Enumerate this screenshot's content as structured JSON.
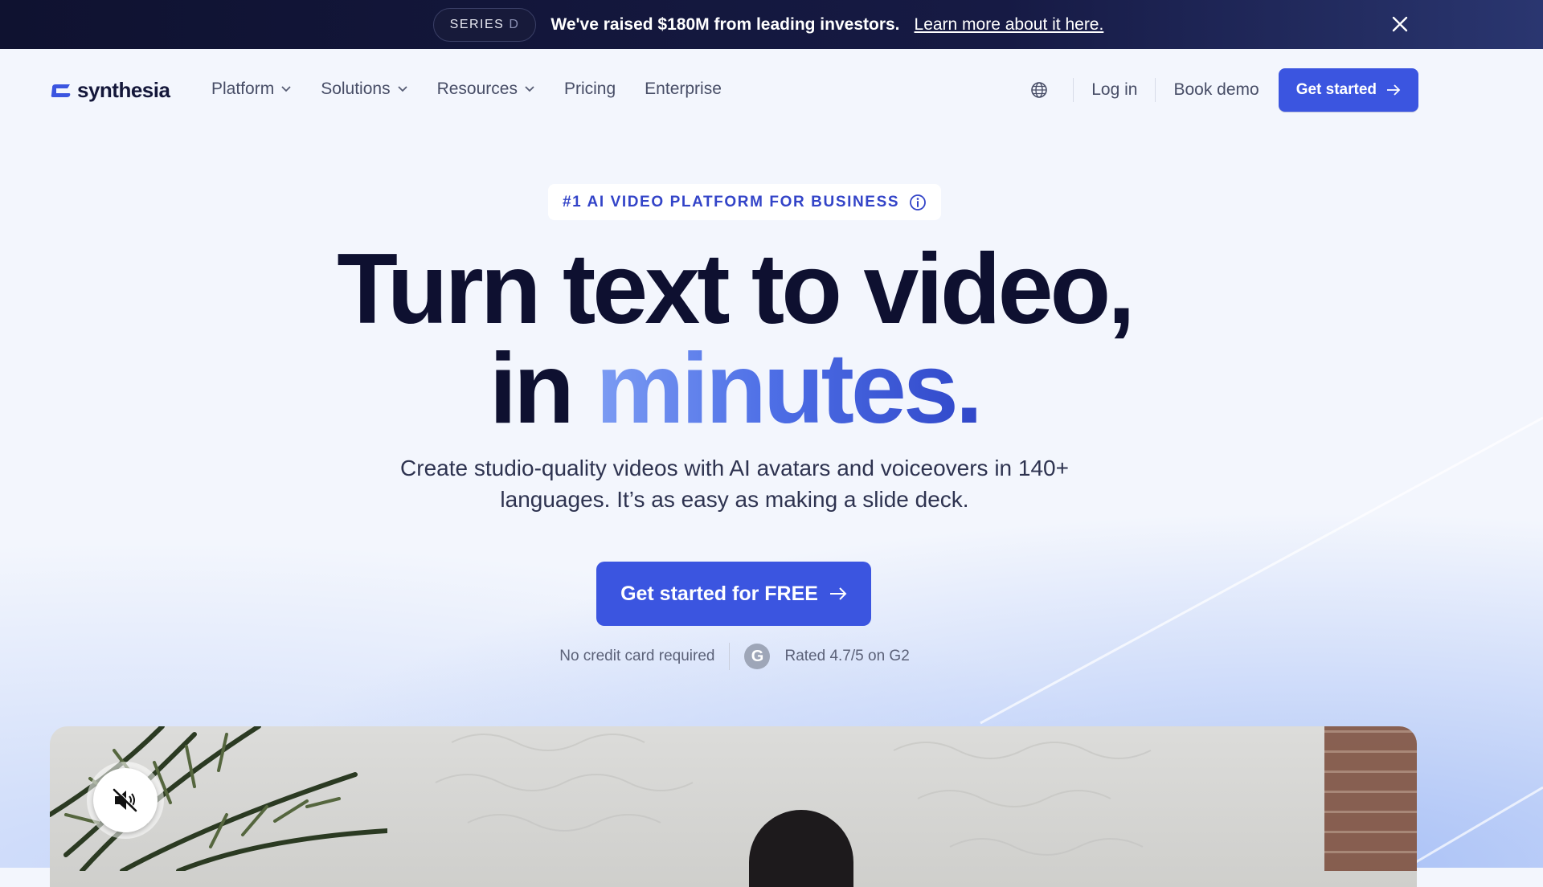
{
  "banner": {
    "series_part1": "SERIES",
    "series_part2": "D",
    "text": "We've raised $180M from leading investors.",
    "link": "Learn more about it here."
  },
  "brand": {
    "name": "synthesia",
    "accent": "#3b55e0",
    "dark": "#0e1030"
  },
  "nav": {
    "items": [
      {
        "label": "Platform",
        "dropdown": true
      },
      {
        "label": "Solutions",
        "dropdown": true
      },
      {
        "label": "Resources",
        "dropdown": true
      },
      {
        "label": "Pricing",
        "dropdown": false
      },
      {
        "label": "Enterprise",
        "dropdown": false
      }
    ],
    "login": "Log in",
    "book_demo": "Book demo",
    "get_started": "Get started"
  },
  "hero": {
    "eyebrow": "#1 AI VIDEO PLATFORM FOR BUSINESS",
    "headline_line1": "Turn text to video,",
    "headline_line2_a": "in ",
    "headline_line2_b": "minutes.",
    "subtitle": "Create studio-quality videos with AI avatars and voiceovers in 140+ languages. It’s as easy as making a slide deck.",
    "cta": "Get started for FREE",
    "no_card": "No credit card required",
    "g2_letter": "G",
    "rating": "Rated 4.7/5 on G2"
  },
  "icons": {
    "banner_close": "close-icon",
    "globe": "globe-icon",
    "arrow": "arrow-right-icon",
    "info": "info-icon",
    "mute": "volume-muted-icon"
  }
}
